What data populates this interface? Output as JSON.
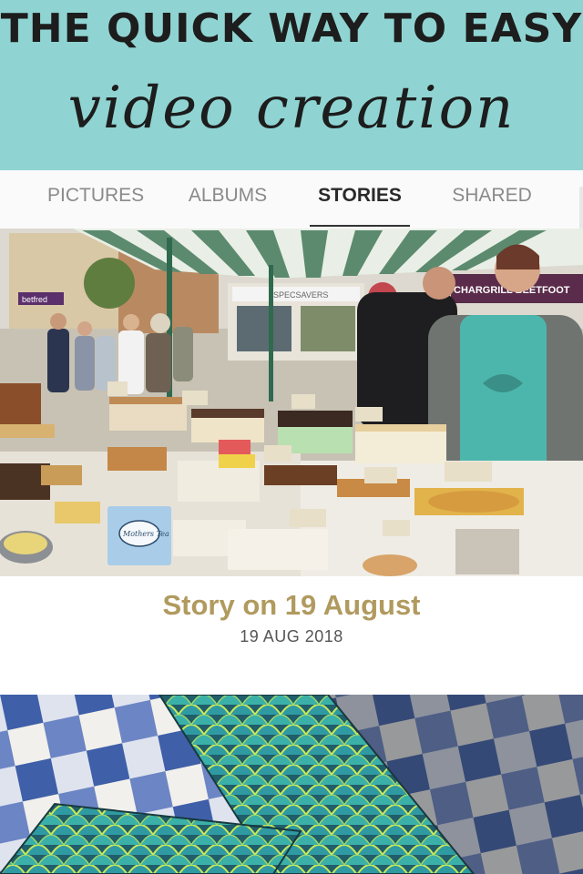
{
  "banner": {
    "line1": "The quick way to easy",
    "line2": "video creation"
  },
  "tabs": [
    {
      "label": "PICTURES",
      "active": false
    },
    {
      "label": "ALBUMS",
      "active": false
    },
    {
      "label": "STORIES",
      "active": true
    },
    {
      "label": "SHARED",
      "active": false
    }
  ],
  "story": {
    "title": "Story on 19 August",
    "date": "19 AUG 2018",
    "play_icon": "play-icon"
  },
  "photo_signs": {
    "shop_left": "betfred",
    "shop_center": "SPECSAVERS",
    "stall_banner": "CHARGRILL BEETFOOT",
    "cake_tag": "Mothers Tea"
  },
  "colors": {
    "banner_bg": "#8fd4d2",
    "story_title": "#b09a5e",
    "apron": "#4db6ac"
  }
}
